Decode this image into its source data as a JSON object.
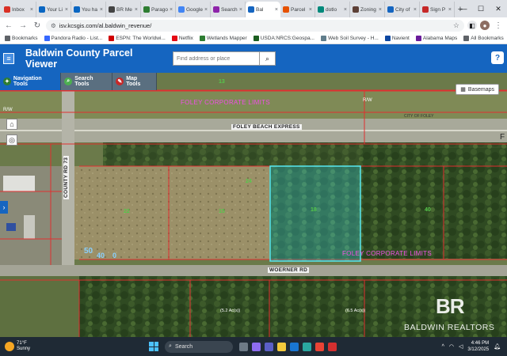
{
  "browser": {
    "tabs": [
      {
        "label": "Inbox",
        "color": "#d93025",
        "active": false
      },
      {
        "label": "Your Li",
        "color": "#0a66c2",
        "active": false
      },
      {
        "label": "You ha",
        "color": "#0a66c2",
        "active": false
      },
      {
        "label": "BR Me",
        "color": "#444444",
        "active": false
      },
      {
        "label": "Parago",
        "color": "#2e7d32",
        "active": false
      },
      {
        "label": "Google",
        "color": "#4285f4",
        "active": false
      },
      {
        "label": "Search",
        "color": "#8e24aa",
        "active": false
      },
      {
        "label": "Bal",
        "color": "#1565c0",
        "active": true
      },
      {
        "label": "Parcel",
        "color": "#e65100",
        "active": false
      },
      {
        "label": "dotlo",
        "color": "#00897b",
        "active": false
      },
      {
        "label": "Zoning",
        "color": "#5d4037",
        "active": false
      },
      {
        "label": "City of",
        "color": "#1565c0",
        "active": false
      },
      {
        "label": "Sign P",
        "color": "#c62828",
        "active": false
      }
    ],
    "url": "isv.kcsgis.com/al.baldwin_revenue/",
    "bookmarks": [
      {
        "label": "Bookmarks",
        "color": "#5f6368"
      },
      {
        "label": "Pandora Radio - List...",
        "color": "#3668ff"
      },
      {
        "label": "ESPN: The Worldwi...",
        "color": "#d00000"
      },
      {
        "label": "Netflix",
        "color": "#e50914"
      },
      {
        "label": "Wetlands Mapper",
        "color": "#2e7d32"
      },
      {
        "label": "USDA:NRCS:Geospa...",
        "color": "#1b5e20"
      },
      {
        "label": "Web Soil Survey - H...",
        "color": "#607d8b"
      },
      {
        "label": "Navient",
        "color": "#0d47a1"
      },
      {
        "label": "Alabama Maps",
        "color": "#6a1b9a"
      }
    ],
    "all_bookmarks": "All Bookmarks"
  },
  "app": {
    "title": "Baldwin County Parcel Viewer",
    "search_placeholder": "Find address or place",
    "help_label": "?",
    "tools": [
      {
        "label": "Navigation Tools",
        "active": true
      },
      {
        "label": "Search Tools",
        "active": false
      },
      {
        "label": "Map Tools",
        "active": false
      }
    ],
    "basemaps_label": "Basemaps"
  },
  "map": {
    "labels": {
      "foley_limits_top": "FOLEY CORPORATE LIMITS",
      "foley_limits_bottom": "FOLEY CORPORATE LIMITS",
      "foley_beach_express": "FOLEY BEACH EXPRESS",
      "city_of_foley": "CITY OF FOLEY",
      "county_rd": "COUNTY RD 73",
      "woerner_rd": "WOERNER RD",
      "row_top_left": "R/W",
      "row_top_right": "R/W",
      "acres_left": "(5.2 Ac(s))",
      "acres_right": "(6.5 Ac(s))",
      "parcel_a": "24",
      "parcel_b": "18",
      "parcel_c": "13",
      "parcel_d": "22",
      "parcel_e": "15",
      "parcel_f": "40",
      "road_50": "50",
      "road_40": "40",
      "road_0": "0",
      "edge_f": "F"
    },
    "watermark_logo": "BR",
    "watermark_text": "BALDWIN REALTORS"
  },
  "taskbar": {
    "temp": "71°F",
    "condition": "Sunny",
    "search_label": "Search",
    "time": "4:46 PM",
    "date": "3/12/2025"
  }
}
